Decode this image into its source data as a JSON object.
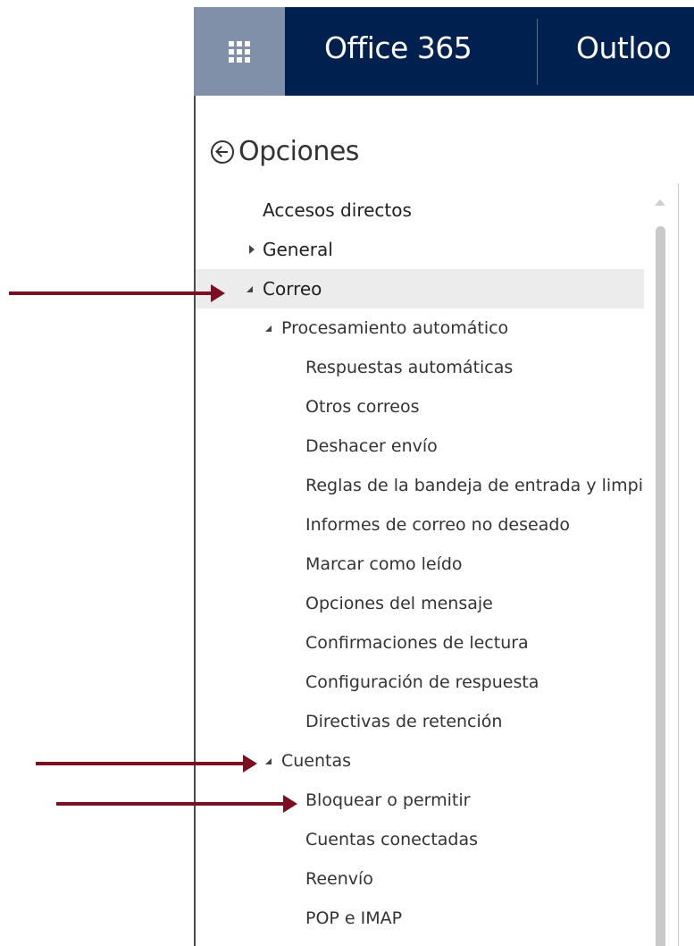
{
  "topbar": {
    "brand": "Office 365",
    "app": "Outloo",
    "launcher_icon": "app-launcher-waffle-icon",
    "background": "#002050",
    "launcher_background": "#7f90a8"
  },
  "options": {
    "back_icon": "circle-back-arrow-icon",
    "title": "Opciones"
  },
  "nav": {
    "accesos_directos": "Accesos directos",
    "general": "General",
    "correo": "Correo",
    "procesamiento": "Procesamiento automático",
    "respuestas": "Respuestas automáticas",
    "otros": "Otros correos",
    "deshacer": "Deshacer envío",
    "reglas": "Reglas de la bandeja de entrada y limpieza",
    "informes": "Informes de correo no deseado",
    "marcar": "Marcar como leído",
    "opciones_mensaje": "Opciones del mensaje",
    "confirmaciones": "Confirmaciones de lectura",
    "config_respuesta": "Configuración de respuesta",
    "directivas": "Directivas de retención",
    "cuentas": "Cuentas",
    "bloquear": "Bloquear o permitir",
    "conectadas": "Cuentas conectadas",
    "reenvio": "Reenvío",
    "pop": "POP e IMAP"
  },
  "annotation_color": "#7b1020"
}
